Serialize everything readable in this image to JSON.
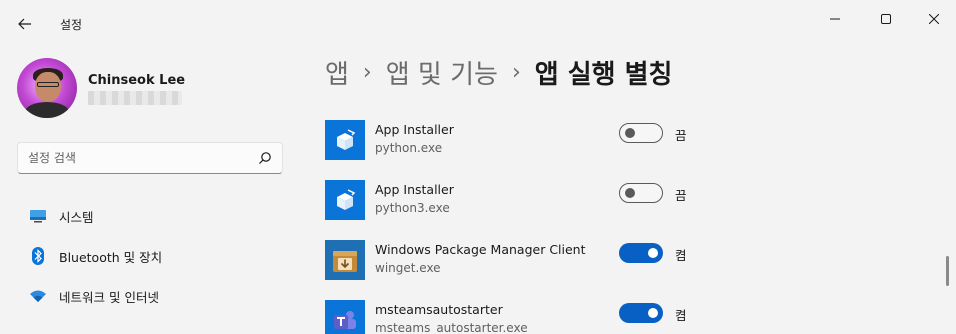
{
  "window": {
    "title": "설정"
  },
  "user": {
    "name": "Chinseok Lee"
  },
  "search": {
    "placeholder": "설정 검색"
  },
  "sidebar": {
    "items": [
      {
        "label": "시스템",
        "icon": "monitor-icon"
      },
      {
        "label": "Bluetooth 및 장치",
        "icon": "bluetooth-icon"
      },
      {
        "label": "네트워크 및 인터넷",
        "icon": "wifi-icon"
      }
    ]
  },
  "breadcrumb": {
    "items": [
      "앱",
      "앱 및 기능",
      "앱 실행 별칭"
    ],
    "separator": "›"
  },
  "aliases": [
    {
      "name": "App Installer",
      "exe": "python.exe",
      "state": "끔",
      "on": false,
      "icon": "package-icon",
      "color": "#0a74d8"
    },
    {
      "name": "App Installer",
      "exe": "python3.exe",
      "state": "끔",
      "on": false,
      "icon": "package-icon",
      "color": "#0a74d8"
    },
    {
      "name": "Windows Package Manager Client",
      "exe": "winget.exe",
      "state": "켬",
      "on": true,
      "icon": "download-box-icon",
      "color": "#c38a38"
    },
    {
      "name": "msteamsautostarter",
      "exe": "msteams_autostarter.exe",
      "state": "켬",
      "on": true,
      "icon": "teams-icon",
      "color": "#5b5fc7"
    }
  ],
  "colors": {
    "accent": "#0860c4",
    "background": "#f3f3f3"
  }
}
